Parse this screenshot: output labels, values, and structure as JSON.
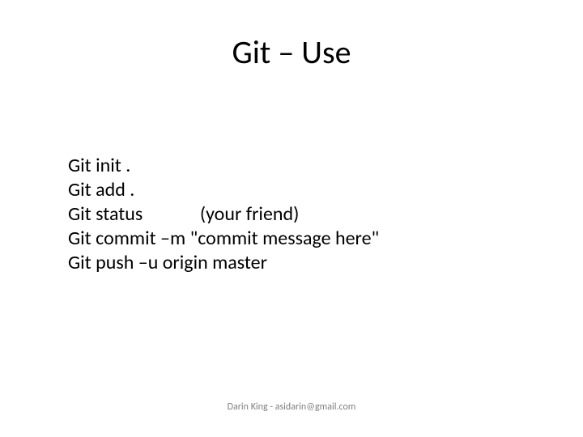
{
  "title": "Git – Use",
  "lines": {
    "l0": "Git init .",
    "l1": "Git add .",
    "l2": "Git status             (your friend)",
    "l3": "Git commit –m \"commit message here\"",
    "l4": "Git push –u origin master"
  },
  "footer": "Darin King - asidarin@gmail.com"
}
